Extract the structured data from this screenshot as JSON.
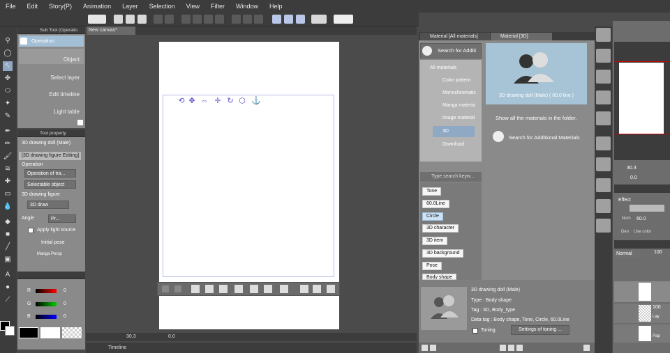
{
  "menu": [
    "File",
    "Edit",
    "Story(P)",
    "Animation",
    "Layer",
    "Selection",
    "View",
    "Filter",
    "Window",
    "Help"
  ],
  "subtool_panel": {
    "title": "Sub Tool (Operatio",
    "group": "Operation",
    "items": [
      "Object",
      "Select layer",
      "Edit timeline",
      "Light table"
    ]
  },
  "tool_property": {
    "title": "Tool property",
    "target": "3D drawing doll (Male)",
    "mode_label": "[3D drawing figure Editing]",
    "section": "Operation",
    "op_target": "Operation of tra...",
    "selectable": "Selectable object",
    "figure_section": "3D drawing figure",
    "figure_value": "3D draw",
    "angle_label": "Angle",
    "angle_value": "Pr...",
    "light_source": "Apply light source",
    "initial_pose": "Initial pose",
    "manga_perspective": "Manga Persp"
  },
  "color_panel": {
    "labels": [
      "R",
      "G",
      "B"
    ],
    "values": [
      "0",
      "0",
      "0"
    ]
  },
  "canvas": {
    "tab": "New canvas*",
    "zoom": "30.3",
    "angle": "0.0"
  },
  "timeline": {
    "label": "Timeline"
  },
  "material_panel": {
    "tabs": [
      "Material [All materials]",
      "Material [3D]"
    ],
    "search_button": "Search for Additi",
    "tree": [
      "All materials",
      "Color pattern",
      "Monochromatic",
      "Manga materia",
      "Image material",
      "3D",
      "Download"
    ],
    "tag_search_placeholder": "Type search keyw...",
    "tags": [
      "Tone",
      "60.0Line",
      "Circle",
      "3D character",
      "3D item",
      "3D background",
      "Pose",
      "Body shape"
    ],
    "selected_tag": "Circle",
    "material_name": "3D drawing doll (Male) ( 60.0 line )",
    "info": "Show all the materials in the folder.",
    "additional": "Search for Additional Materials",
    "detail": {
      "name": "3D drawing doll (Male)",
      "type": "Type : Body shape",
      "tag": "Tag : 3D, Body_type",
      "data_tag": "Data tag : Body shape, Tone, Circle, 60.0Line",
      "toning": "Toning",
      "settings_button": "Settings of toning ..."
    }
  },
  "right_panel": {
    "nav_zoom": "30.3",
    "nav_angle": "0.0",
    "effect_title": "Effect",
    "effect_value": "60.0",
    "blend_mode": "Normal",
    "opacity": "100",
    "layer_opacity": "100",
    "layer_texts": [
      "Num",
      "Den",
      "Use color",
      "Lay",
      "Pap"
    ]
  }
}
